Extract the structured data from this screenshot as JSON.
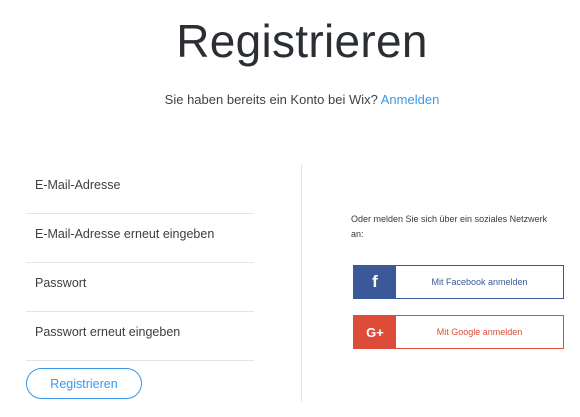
{
  "header": {
    "title": "Registrieren",
    "subtitle_text": "Sie haben bereits ein Konto bei Wix?",
    "login_link": "Anmelden"
  },
  "form": {
    "email_placeholder": "E-Mail-Adresse",
    "email_confirm_placeholder": "E-Mail-Adresse erneut eingeben",
    "password_placeholder": "Passwort",
    "password_confirm_placeholder": "Passwort erneut eingeben",
    "submit_label": "Registrieren"
  },
  "social": {
    "intro_text": "Oder melden Sie sich über ein soziales Netzwerk an:",
    "facebook": {
      "icon": "facebook-icon",
      "icon_glyph": "f",
      "label": "Mit Facebook anmelden",
      "color": "#3b5998"
    },
    "google": {
      "icon": "google-plus-icon",
      "icon_glyph": "G+",
      "label": "Mit Google anmelden",
      "color": "#dd4b39"
    }
  },
  "colors": {
    "accent": "#3899ec",
    "divider": "#e3e6e9"
  }
}
